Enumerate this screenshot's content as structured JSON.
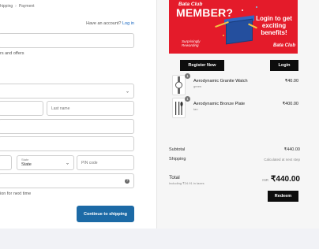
{
  "breadcrumb": {
    "shipping": "hipping",
    "payment": "Payment"
  },
  "account": {
    "prompt": "Have an account?",
    "login": "Log in"
  },
  "form": {
    "offers_text": "rs and offers",
    "last_name_placeholder": "Last name",
    "state_label": "State",
    "state_value": "State",
    "pin_placeholder": "PIN code",
    "save_text": "ion for next time",
    "continue_button": "Continue to shipping"
  },
  "banner": {
    "brand": "Bata Club",
    "headline": "MEMBER?",
    "promo": "Login to get exciting benefits!",
    "tagline_1": "Surprisingly",
    "tagline_2": "Rewarding",
    "logo": "Bata Club"
  },
  "actions": {
    "register": "Register Now",
    "login": "Login"
  },
  "cart": [
    {
      "qty": "1",
      "name": "Aerodynamic Granite Watch",
      "variant": "green",
      "price": "₹40.00",
      "thumb_icon": "watch-thumbnail"
    },
    {
      "qty": "1",
      "name": "Aerodynamic Bronze Plate",
      "variant": "tan",
      "price": "₹400.00",
      "thumb_icon": "cutlery-thumbnail"
    }
  ],
  "summary": {
    "subtotal_label": "Subtotal",
    "subtotal_value": "₹440.00",
    "shipping_label": "Shipping",
    "shipping_value": "Calculated at next step",
    "total_label": "Total",
    "tax_note": "Including ₹24.91 in taxes",
    "currency": "INR",
    "total_value": "₹440.00",
    "redeem": "Redeem"
  },
  "colors": {
    "accent": "#1c6aa6",
    "banner": "#e41b2a",
    "dark": "#0d0d0d"
  }
}
